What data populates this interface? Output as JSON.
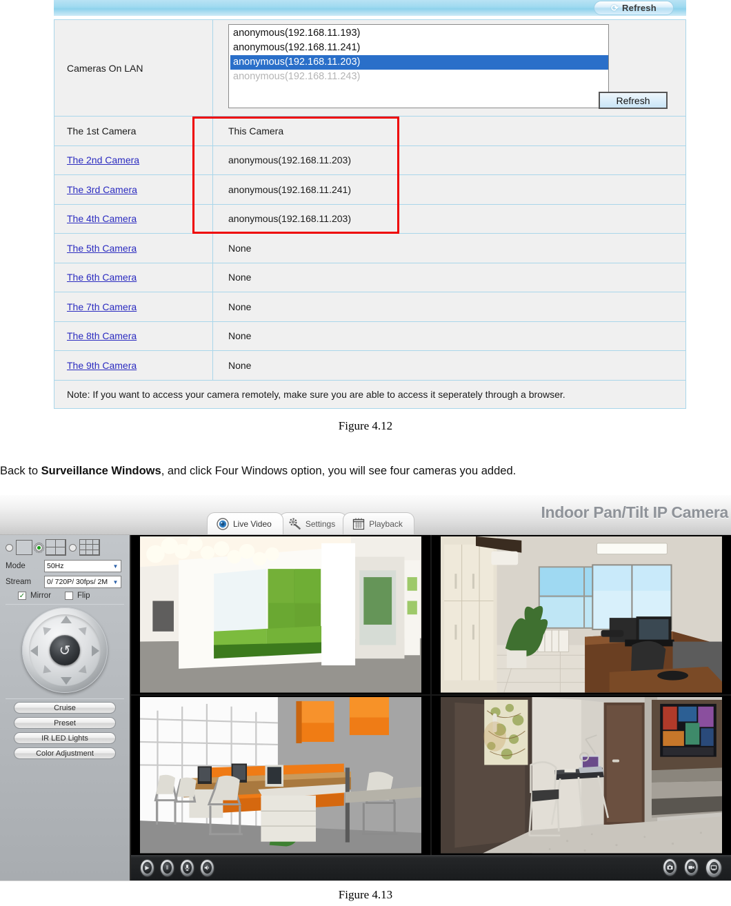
{
  "settings_panel": {
    "top_refresh_label": "Refresh",
    "lan_section": {
      "label": "Cameras On LAN",
      "options": [
        {
          "text": "anonymous(192.168.11.193)",
          "state": "normal"
        },
        {
          "text": "anonymous(192.168.11.241)",
          "state": "normal"
        },
        {
          "text": "anonymous(192.168.11.203)",
          "state": "selected"
        },
        {
          "text": "anonymous(192.168.11.243)",
          "state": "dim"
        }
      ],
      "refresh_label": "Refresh"
    },
    "rows": [
      {
        "name": "The 1st Camera",
        "is_link": false,
        "value": "This Camera"
      },
      {
        "name": "The 2nd Camera",
        "is_link": true,
        "value": "anonymous(192.168.11.203)"
      },
      {
        "name": "The 3rd Camera",
        "is_link": true,
        "value": "anonymous(192.168.11.241)"
      },
      {
        "name": "The 4th Camera",
        "is_link": true,
        "value": "anonymous(192.168.11.203)"
      },
      {
        "name": "The 5th Camera",
        "is_link": true,
        "value": "None"
      },
      {
        "name": "The 6th Camera",
        "is_link": true,
        "value": "None"
      },
      {
        "name": "The 7th Camera",
        "is_link": true,
        "value": "None"
      },
      {
        "name": "The 8th Camera",
        "is_link": true,
        "value": "None"
      },
      {
        "name": "The 9th Camera",
        "is_link": true,
        "value": "None"
      }
    ],
    "note": "Note: If you want to access your camera remotely, make sure you are able to access it seperately through a browser.",
    "highlight_color": "#ee0000"
  },
  "figure_412_caption": "Figure 4.12",
  "figure_413_caption": "Figure 4.13",
  "body_text": {
    "part1": "Back to ",
    "bold": "Surveillance Windows",
    "part2": ", and click Four Windows option, you will see four cameras you added."
  },
  "camera_ui": {
    "title": "Indoor Pan/Tilt IP Camera",
    "tabs": [
      {
        "label": "Live Video",
        "icon": "camera-icon",
        "active": true
      },
      {
        "label": "Settings",
        "icon": "gear-wrench-icon",
        "active": false
      },
      {
        "label": "Playback",
        "icon": "calendar-icon",
        "active": false
      }
    ],
    "sidebar": {
      "layouts": [
        {
          "name": "single-window",
          "selected": false
        },
        {
          "name": "four-windows",
          "selected": true
        },
        {
          "name": "nine-windows",
          "selected": false
        }
      ],
      "mode": {
        "label": "Mode",
        "value": "50Hz"
      },
      "stream": {
        "label": "Stream",
        "value": "0/ 720P/ 30fps/ 2M"
      },
      "mirror": {
        "label": "Mirror",
        "checked": true,
        "mark": "✓"
      },
      "flip": {
        "label": "Flip",
        "checked": false,
        "mark": ""
      },
      "ptz": {
        "center_icon": "↺"
      },
      "buttons": [
        {
          "label": "Cruise"
        },
        {
          "label": "Preset"
        },
        {
          "label": "IR LED Lights"
        },
        {
          "label": "Color Adjustment"
        }
      ]
    },
    "video_cells": [
      {
        "name": "camera-1-view",
        "description": "white office lobby with green bench and pendant lights"
      },
      {
        "name": "camera-2-view",
        "description": "office room with wooden desk, windows and plant"
      },
      {
        "name": "camera-3-view",
        "description": "open-plan office with orange partitions and monitors"
      },
      {
        "name": "camera-4-view",
        "description": "hotel room with desk, laptop and wall TV"
      }
    ],
    "toolbar": {
      "left": [
        {
          "name": "play-button",
          "glyph": "▶"
        },
        {
          "name": "pause-button",
          "glyph": "‖"
        },
        {
          "name": "microphone-button",
          "glyph": "♉"
        },
        {
          "name": "speaker-button",
          "glyph": "◀"
        }
      ],
      "right": [
        {
          "name": "snapshot-button",
          "glyph": "▣"
        },
        {
          "name": "record-button",
          "glyph": "▤"
        },
        {
          "name": "fullscreen-button",
          "glyph": "⬜"
        }
      ]
    }
  }
}
